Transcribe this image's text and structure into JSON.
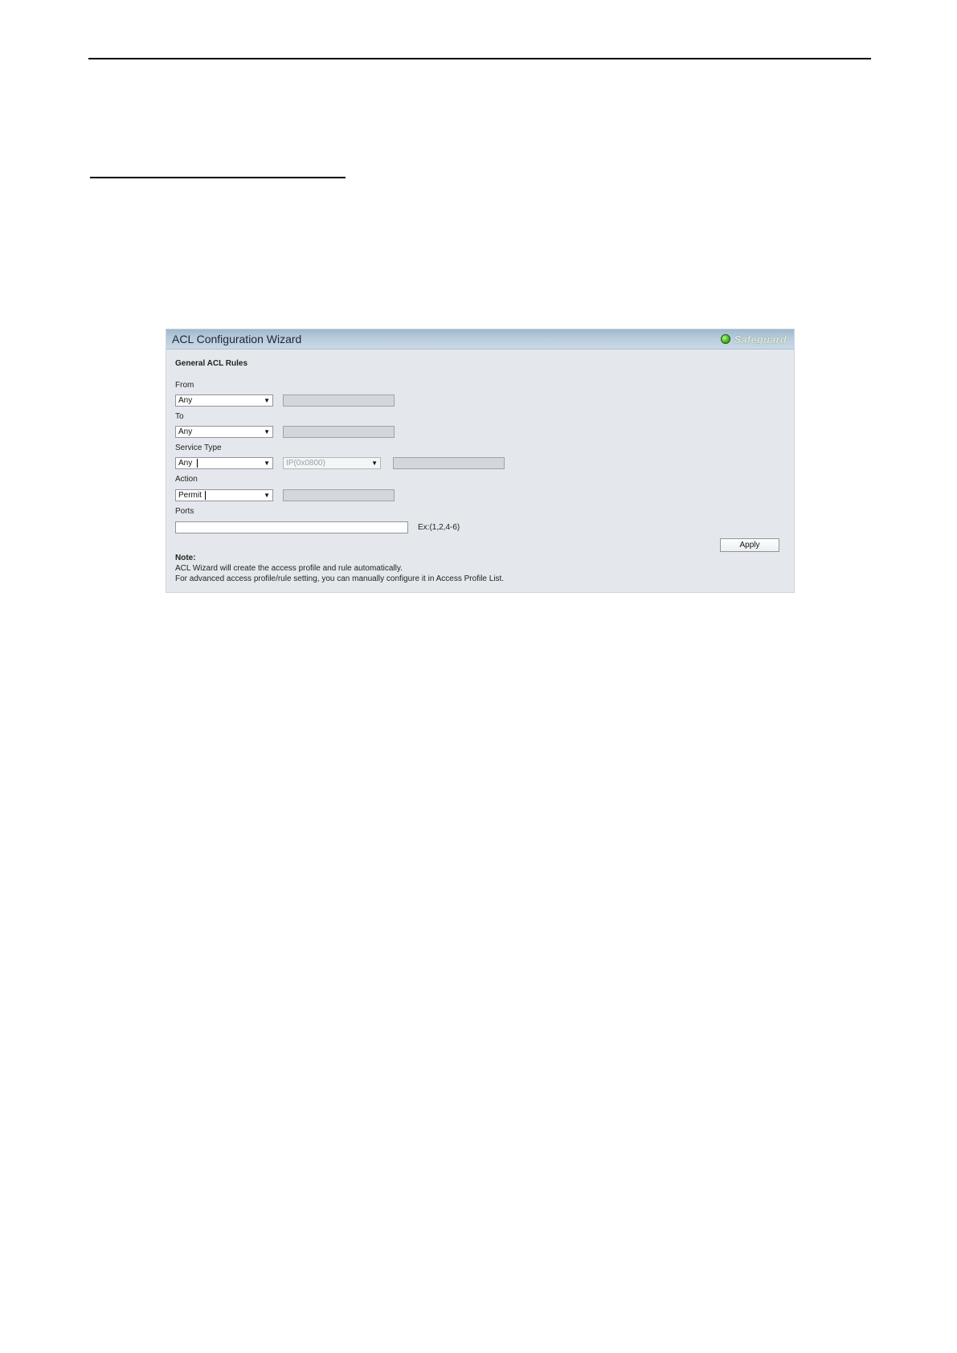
{
  "panel": {
    "title": "ACL Configuration Wizard",
    "safeguard_label": "Safeguard",
    "indicator_color": "#4fc22a",
    "header_color": "#b9cbdc",
    "background_color": "#e4e8ec"
  },
  "form": {
    "section_title": "General ACL Rules",
    "from": {
      "label": "From",
      "value": "Any"
    },
    "to": {
      "label": "To",
      "value": "Any"
    },
    "service_type": {
      "label": "Service Type",
      "value": "Any",
      "ethertype_value": "IP(0x0800)"
    },
    "action": {
      "label": "Action",
      "value": "Permit"
    },
    "ports": {
      "label": "Ports",
      "value": "",
      "hint": "Ex:(1,2,4-6)"
    },
    "apply_label": "Apply"
  },
  "note": {
    "heading": "Note:",
    "line1": "ACL Wizard will create the access profile and rule automatically.",
    "line2": "For advanced access profile/rule setting, you can manually configure it in Access Profile List."
  }
}
